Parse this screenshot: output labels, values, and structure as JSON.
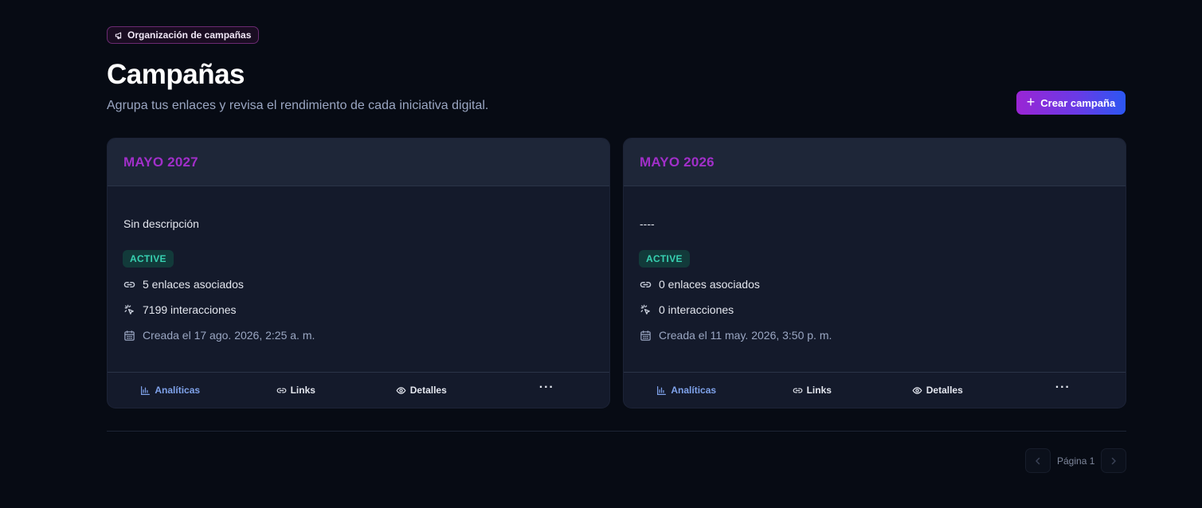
{
  "header": {
    "chip_label": "Organización de campañas",
    "title": "Campañas",
    "subtitle": "Agrupa tus enlaces y revisa el rendimiento de cada iniciativa digital.",
    "create_button": "Crear campaña"
  },
  "campaigns": [
    {
      "name": "MAYO 2027",
      "description": "Sin descripción",
      "status": "ACTIVE",
      "links": "5 enlaces asociados",
      "interactions": "7199 interacciones",
      "created": "Creada el 17 ago. 2026, 2:25 a. m."
    },
    {
      "name": "MAYO 2026",
      "description": "----",
      "status": "ACTIVE",
      "links": "0 enlaces asociados",
      "interactions": "0 interacciones",
      "created": "Creada el 11 may. 2026, 3:50 p. m."
    }
  ],
  "card_actions": {
    "analytics": "Analíticas",
    "links": "Links",
    "details": "Detalles",
    "more": "···"
  },
  "pagination": {
    "label": "Página 1"
  },
  "colors": {
    "background": "#070b14",
    "card": "#141a2b",
    "card_header": "#1e2638",
    "campaign_name": "#a12fc9",
    "status_active_text": "#37d1b1",
    "status_active_bg": "#123a3a",
    "active_action": "#7fa2ea"
  },
  "icons": {
    "chip": "megaphone-icon",
    "create": "plus-icon",
    "links": "link-icon",
    "interactions": "cursor-click-icon",
    "created": "calendar-icon",
    "analytics": "bar-chart-icon",
    "details": "eye-icon",
    "more": "ellipsis-icon",
    "prev": "chevron-left-icon",
    "next": "chevron-right-icon"
  }
}
